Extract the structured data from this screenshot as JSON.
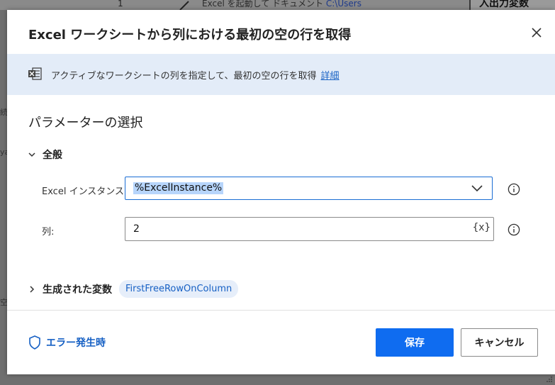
{
  "background": {
    "line_number": "1",
    "action_text": "Excel を起動して ドキュメント ",
    "action_path": "C:\\Users",
    "right_panel_title": "入出力変数",
    "left_fragments": [
      "続",
      "ya",
      "空"
    ]
  },
  "dialog": {
    "title": "Excel ワークシートから列における最初の空の行を取得",
    "close_icon": "close-icon"
  },
  "info_bar": {
    "icon": "excel-icon",
    "text": "アクティブなワークシートの列を指定して、最初の空の行を取得",
    "link": "詳細"
  },
  "parameters": {
    "section_title": "パラメーターの選択",
    "group_label": "全般",
    "fields": [
      {
        "label": "Excel インスタンス:",
        "value": "%ExcelInstance%",
        "type": "select"
      },
      {
        "label": "列:",
        "value": "2",
        "type": "text",
        "var_button": "{x}"
      }
    ]
  },
  "variables": {
    "label": "生成された変数",
    "items": [
      "FirstFreeRowOnColumn"
    ]
  },
  "footer": {
    "on_error": "エラー発生時",
    "save": "保存",
    "cancel": "キャンセル"
  },
  "colors": {
    "accent": "#0f6cf0",
    "link": "#1660c4",
    "info_bar_bg": "#e3ecf8",
    "selection_bg": "#b7d5fb"
  }
}
